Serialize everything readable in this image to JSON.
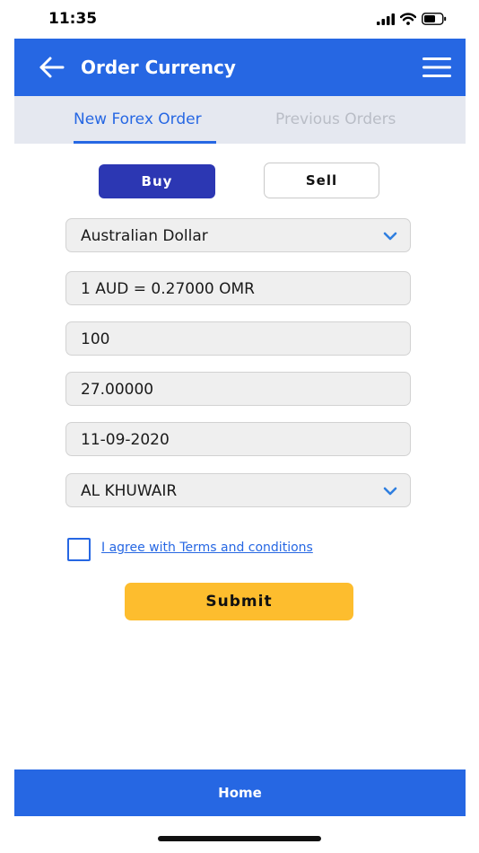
{
  "status_bar": {
    "time": "11:35",
    "icons": [
      "signal-icon",
      "wifi-icon",
      "battery-icon"
    ]
  },
  "header": {
    "back_icon": "arrow-left-icon",
    "title": "Order Currency",
    "menu_icon": "hamburger-menu-icon"
  },
  "tabs": [
    {
      "label": "New Forex Order",
      "active": true
    },
    {
      "label": "Previous Orders",
      "active": false
    }
  ],
  "order_type": {
    "buy_label": "Buy",
    "sell_label": "Sell",
    "selected": "Buy"
  },
  "form": {
    "currency": "Australian Dollar",
    "rate": "1 AUD = 0.27000 OMR",
    "amount": "100",
    "converted": "27.00000",
    "date": "11-09-2020",
    "branch": "AL KHUWAIR"
  },
  "terms": {
    "checked": false,
    "label": "I agree with Terms and conditions"
  },
  "submit_label": "Submit",
  "bottom_nav": {
    "label": "Home"
  },
  "colors": {
    "primary": "#2667e3",
    "buy_button": "#2c37b3",
    "submit_button": "#fdbd2e",
    "tab_background": "#e5e8f0",
    "field_background": "#efefef"
  }
}
